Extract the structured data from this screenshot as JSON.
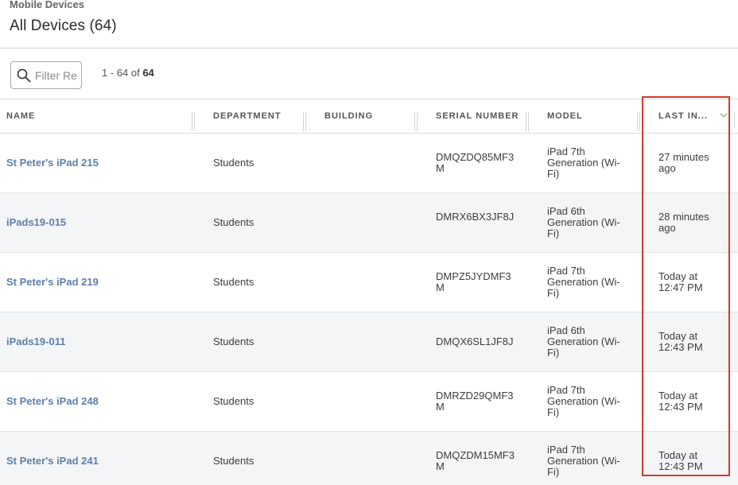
{
  "header": {
    "breadcrumb": "Mobile Devices",
    "title": "All Devices (64)"
  },
  "toolbar": {
    "filter_placeholder": "Filter Re",
    "pagination_prefix": "1 - 64 of ",
    "pagination_total": "64"
  },
  "table": {
    "columns": [
      "NAME",
      "DEPARTMENT",
      "BUILDING",
      "SERIAL NUMBER",
      "MODEL",
      "LAST IN..."
    ],
    "rows": [
      {
        "name": "St Peter's iPad 215",
        "department": "Students",
        "building": "",
        "serial": "DMQZDQ85MF3M",
        "model": "iPad 7th Generation (Wi-Fi)",
        "last": "27 minutes ago"
      },
      {
        "name": "iPads19-015",
        "department": "Students",
        "building": "",
        "serial": "DMRX6BX3JF8J",
        "model": "iPad 6th Generation (Wi-Fi)",
        "last": "28 minutes ago"
      },
      {
        "name": "St Peter's iPad 219",
        "department": "Students",
        "building": "",
        "serial": "DMPZ5JYDMF3M",
        "model": "iPad 7th Generation (Wi-Fi)",
        "last": "Today at 12:47 PM"
      },
      {
        "name": "iPads19-011",
        "department": "Students",
        "building": "",
        "serial": "DMQX6SL1JF8J",
        "model": "iPad 6th Generation (Wi-Fi)",
        "last": "Today at 12:43 PM"
      },
      {
        "name": "St Peter's iPad 248",
        "department": "Students",
        "building": "",
        "serial": "DMRZD29QMF3M",
        "model": "iPad 7th Generation (Wi-Fi)",
        "last": "Today at 12:43 PM"
      },
      {
        "name": "St Peter's iPad 241",
        "department": "Students",
        "building": "",
        "serial": "DMQZDM15MF3M",
        "model": "iPad 7th Generation (Wi-Fi)",
        "last": "Today at 12:43 PM"
      }
    ]
  },
  "icons": {
    "search": "search-icon",
    "sort": "chevron-down-icon"
  },
  "colors": {
    "link": "#5d7fa8",
    "highlight": "#d63a2b",
    "alt_row": "#f4f5f7"
  }
}
